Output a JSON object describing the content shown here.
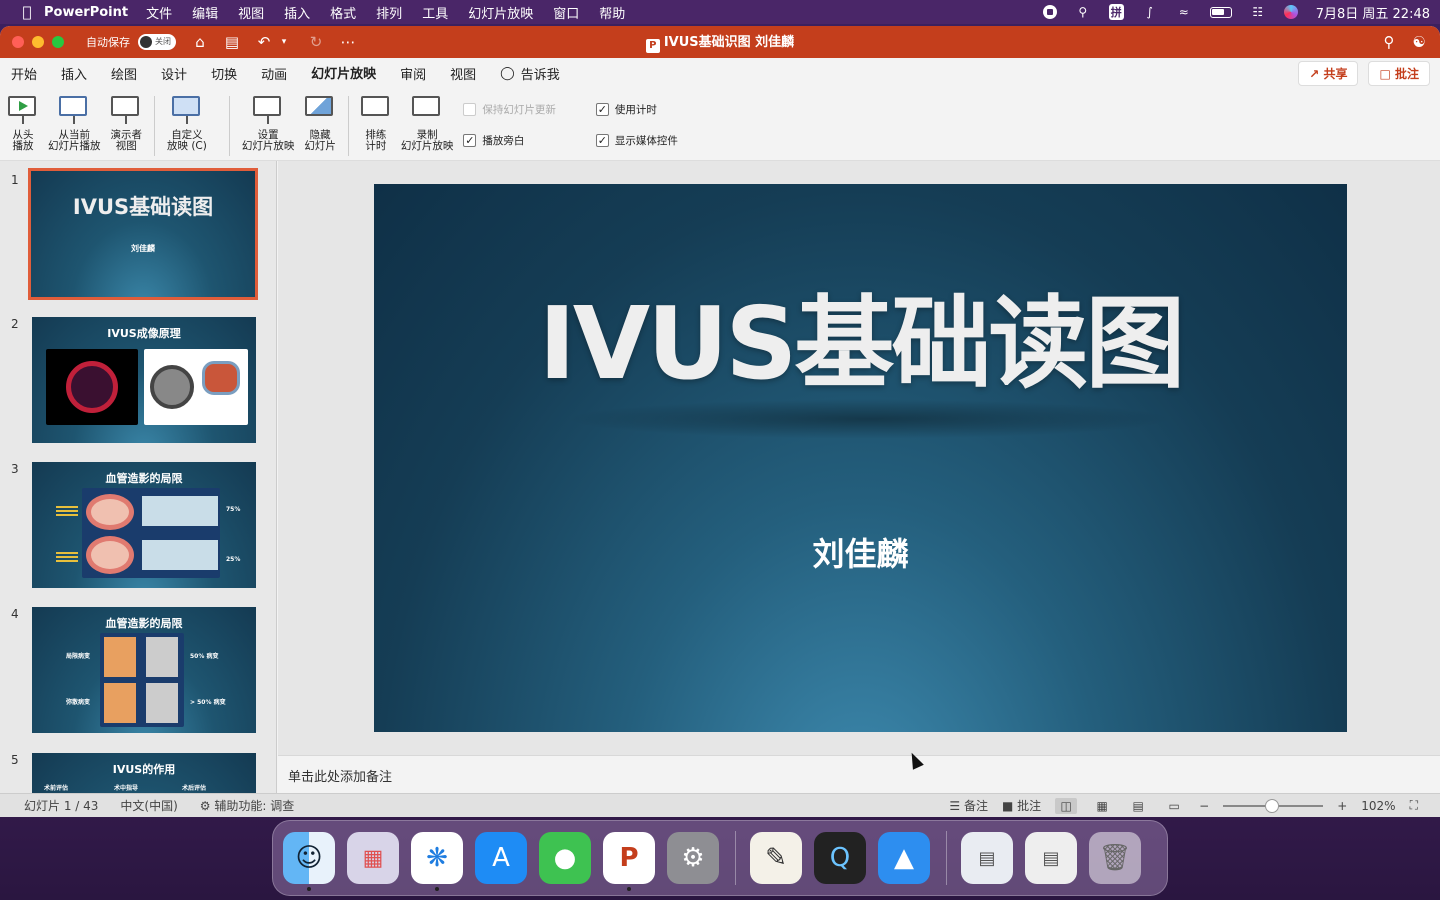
{
  "menubar": {
    "app_name": "PowerPoint",
    "items": [
      "文件",
      "编辑",
      "视图",
      "插入",
      "格式",
      "排列",
      "工具",
      "幻灯片放映",
      "窗口",
      "帮助"
    ],
    "ime_label": "拼",
    "datetime": "7月8日 周五  22:48"
  },
  "titlebar": {
    "autosave_label": "自动保存",
    "autosave_state": "关闭",
    "doc_title": "IVUS基础识图 刘佳麟",
    "pp_glyph": "P"
  },
  "ribbon_tabs": {
    "tabs": [
      "开始",
      "插入",
      "绘图",
      "设计",
      "切换",
      "动画",
      "幻灯片放映",
      "审阅",
      "视图"
    ],
    "active_tab": "幻灯片放映",
    "tell_me": "告诉我",
    "share": "共享",
    "comments": "批注"
  },
  "ribbon": {
    "from_start": [
      "从头",
      "播放"
    ],
    "from_current": [
      "从当前",
      "幻灯片播放"
    ],
    "presenter": [
      "演示者",
      "视图"
    ],
    "custom": [
      "自定义",
      "放映 (C)"
    ],
    "setup": [
      "设置",
      "幻灯片放映"
    ],
    "hide": [
      "隐藏",
      "幻灯片"
    ],
    "rehearse": [
      "排练",
      "计时"
    ],
    "record": [
      "录制",
      "幻灯片放映"
    ],
    "keep_updated": "保持幻灯片更新",
    "play_narration": "播放旁白",
    "use_timings": "使用计时",
    "show_media_controls": "显示媒体控件",
    "check_glyph": "✓"
  },
  "thumbnails": [
    {
      "num": "1",
      "title": "IVUS基础读图",
      "subtitle": "刘佳麟"
    },
    {
      "num": "2",
      "title": "IVUS成像原理"
    },
    {
      "num": "3",
      "title": "血管造影的局限",
      "labels": [
        "75%",
        "25%"
      ]
    },
    {
      "num": "4",
      "title": "血管造影的局限",
      "labels": [
        "局限病变",
        "弥散病变",
        "50% 病变",
        "> 50% 病变"
      ]
    },
    {
      "num": "5",
      "title": "IVUS的作用",
      "labels": [
        "术前评估",
        "术中指导",
        "术后评估"
      ]
    }
  ],
  "slide": {
    "title": "IVUS基础读图",
    "subtitle": "刘佳麟"
  },
  "notes_placeholder": "单击此处添加备注",
  "statusbar": {
    "slide_count": "幻灯片 1 / 43",
    "language": "中文(中国)",
    "accessibility": "辅助功能: 调查",
    "notes": "备注",
    "comments": "批注",
    "zoom": "102%"
  },
  "colors": {
    "accent": "#c43e1c",
    "slide_bg": "#153d55"
  }
}
